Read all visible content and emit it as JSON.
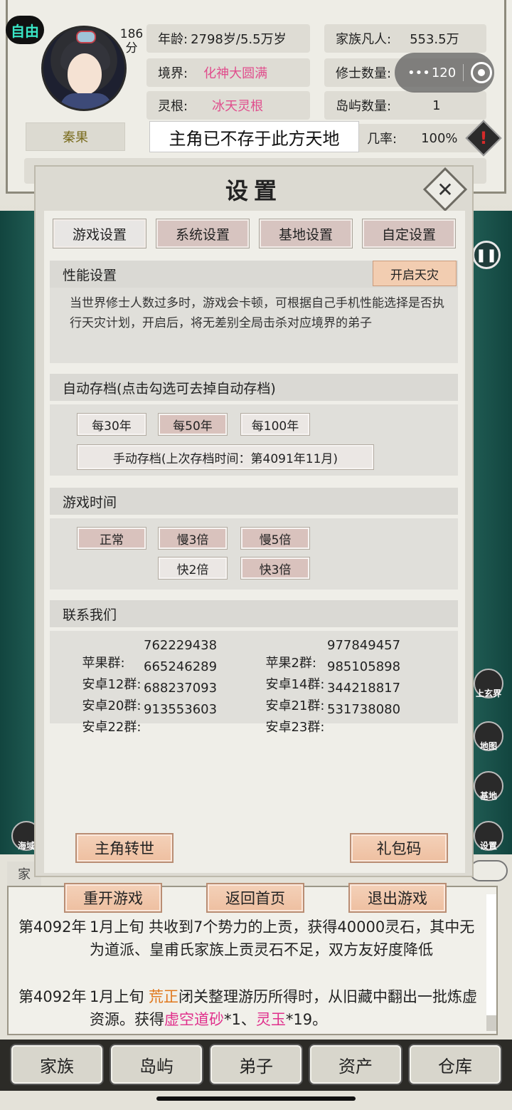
{
  "status": {
    "mode_badge": "自由",
    "score_value": "186",
    "score_unit": "分",
    "character_name": "秦果",
    "age_label": "年龄:",
    "age_value": "2798岁/5.5万岁",
    "realm_label": "境界:",
    "realm_value": "化神大圆满",
    "root_label": "灵根:",
    "root_value": "冰天灵根",
    "mortals_label": "家族凡人:",
    "mortals_value": "553.5万",
    "cultivators_label": "修士数量:",
    "cultivators_value": "120",
    "islands_label": "岛屿数量:",
    "islands_value": "1",
    "rate_label": "几率:",
    "rate_value": "100%",
    "toast": "主角已不存于此方天地",
    "warning_mark": "!"
  },
  "capsule": {
    "more": "•••"
  },
  "side_icons": {
    "upper_realm": "上玄界",
    "map": "地图",
    "base": "基地",
    "settings": "设置",
    "sea": "海域"
  },
  "dialog": {
    "title": "设置",
    "close_glyph": "✕",
    "tabs": [
      "游戏设置",
      "系统设置",
      "基地设置",
      "自定设置"
    ],
    "performance": {
      "header": "性能设置",
      "toggle_label": "开启天灾",
      "description": "当世界修士人数过多时，游戏会卡顿，可根据自己手机性能选择是否执行天灾计划，开启后，将无差别全局击杀对应境界的弟子"
    },
    "autosave": {
      "header": "自动存档(点击勾选可去掉自动存档)",
      "options": [
        "每30年",
        "每50年",
        "每100年"
      ],
      "manual": "手动存档(上次存档时间：第4091年11月)"
    },
    "game_time": {
      "header": "游戏时间",
      "options": [
        "正常",
        "慢3倍",
        "慢5倍",
        "快2倍",
        "快3倍"
      ]
    },
    "contact": {
      "header": "联系我们",
      "groups": [
        {
          "label": "苹果群:",
          "number": "762229438"
        },
        {
          "label": "苹果2群:",
          "number": "977849457"
        },
        {
          "label": "安卓12群:",
          "number": "665246289"
        },
        {
          "label": "安卓14群:",
          "number": "985105898"
        },
        {
          "label": "安卓20群:",
          "number": "688237093"
        },
        {
          "label": "安卓21群:",
          "number": "344218817"
        },
        {
          "label": "安卓22群:",
          "number": "913553603"
        },
        {
          "label": "安卓23群:",
          "number": "531738080"
        }
      ]
    },
    "reincarnate": "主角转世",
    "gift_code": "礼包码",
    "restart": "重开游戏",
    "home": "返回首页",
    "exit": "退出游戏"
  },
  "clan_tab_stub": "家",
  "log": [
    {
      "year": "第4092年",
      "parts": [
        "1月上旬 共收到7个势力的上贡，获得40000灵石，其中无为道派、皇甫氏家族上贡灵石不足，双方友好度降低"
      ]
    },
    {
      "year": "第4092年",
      "prefix": "1月上旬 ",
      "name": "荒正",
      "middle": "闭关整理游历所得时，从旧藏中翻出一批炼虚资源。获得",
      "item1": "虚空道砂",
      "item1_count": "*1、",
      "item2": "灵玉",
      "item2_count": "*19。"
    }
  ],
  "bottom_nav": [
    "家族",
    "岛屿",
    "弟子",
    "资产",
    "仓库"
  ]
}
